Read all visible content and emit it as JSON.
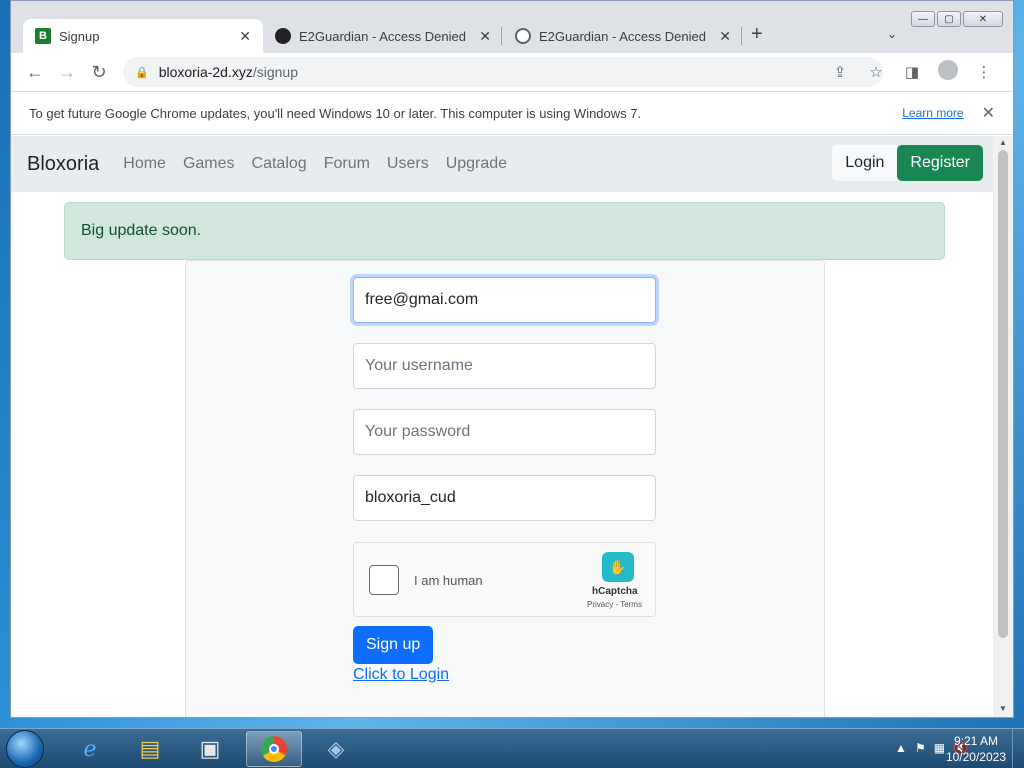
{
  "browser": {
    "tabs": [
      {
        "title": "Signup",
        "favicon": "bloxoria-b-icon",
        "favicon_text": "B",
        "active": true
      },
      {
        "title": "E2Guardian - Access Denied",
        "favicon": "github-icon",
        "active": false
      },
      {
        "title": "E2Guardian - Access Denied",
        "favicon": "globe-icon",
        "active": false
      }
    ],
    "address": {
      "domain": "bloxoria-2d.xyz",
      "path": "/signup"
    },
    "infobar": {
      "message": "To get future Google Chrome updates, you'll need Windows 10 or later. This computer is using Windows 7.",
      "learn_more": "Learn more"
    }
  },
  "site": {
    "brand": "Bloxoria",
    "nav": [
      "Home",
      "Games",
      "Catalog",
      "Forum",
      "Users",
      "Upgrade"
    ],
    "login_label": "Login",
    "register_label": "Register",
    "alert": "Big update soon.",
    "form": {
      "email_value": "free@gmai.com",
      "username_placeholder": "Your username",
      "password_placeholder": "Your password",
      "invite_value": "bloxoria_cud",
      "captcha_label": "I am human",
      "captcha_brand": "hCaptcha",
      "captcha_terms": "Privacy - Terms",
      "signup_label": "Sign up",
      "login_link": "Click to Login"
    },
    "colors": {
      "register": "#198754",
      "signup": "#0d6efd",
      "alert_bg": "#d1e7dd"
    }
  },
  "taskbar": {
    "time": "9:21 AM",
    "date": "10/20/2023"
  }
}
